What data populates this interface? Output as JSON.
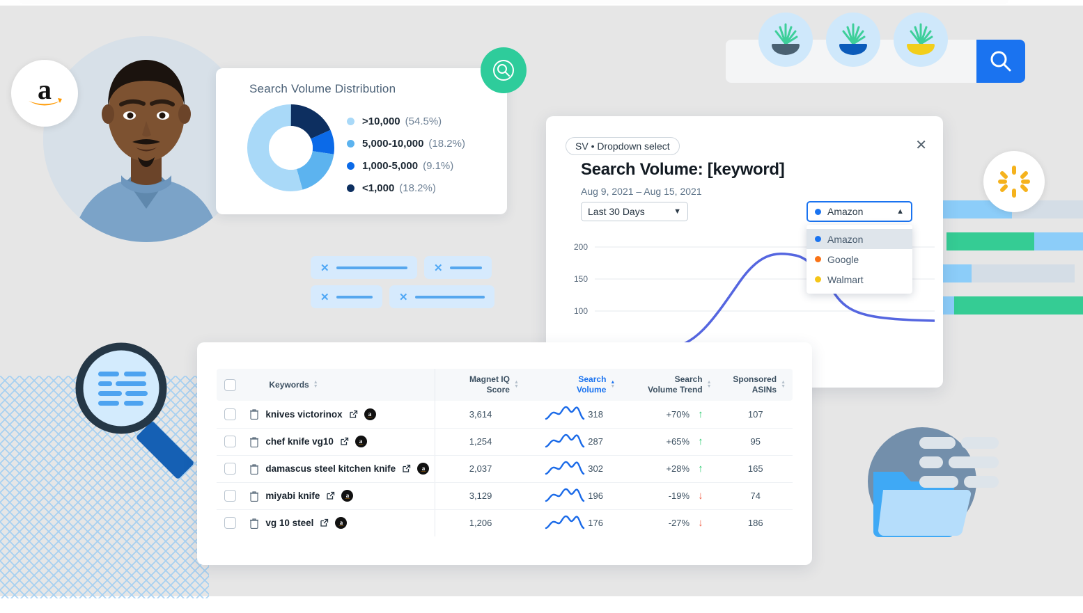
{
  "colors": {
    "accent_blue": "#1a73f0",
    "green": "#2ecc71",
    "red": "#f0634c",
    "amazon_orange": "#ff9900",
    "walmart_yellow": "#f5c518",
    "google_orange": "#f97316",
    "dot_amazon": "#1a73f0",
    "dot_google": "#f97316",
    "dot_walmart": "#f5c518"
  },
  "donut_card": {
    "title": "Search Volume Distribution",
    "legend": [
      {
        "label": ">10,000",
        "pct": "(54.5%)",
        "color": "#a9d9f8"
      },
      {
        "label": "5,000-10,000",
        "pct": "(18.2%)",
        "color": "#5cb3ef"
      },
      {
        "label": "1,000-5,000",
        "pct": "(9.1%)",
        "color": "#0b6ae8"
      },
      {
        "label": "<1,000",
        "pct": "(18.2%)",
        "color": "#0d2f60"
      }
    ]
  },
  "chart_data": [
    {
      "type": "pie",
      "title": "Search Volume Distribution",
      "categories": [
        ">10,000",
        "5,000-10,000",
        "1,000-5,000",
        "<1,000"
      ],
      "values": [
        54.5,
        18.2,
        9.1,
        18.2
      ],
      "colors": [
        "#a9d9f8",
        "#5cb3ef",
        "#0b6ae8",
        "#0d2f60"
      ],
      "legend_position": "right",
      "donut": true
    },
    {
      "type": "line",
      "title": "Search Volume: [keyword]",
      "subtitle": "Aug 9, 2021 – Aug 15, 2021",
      "series": [
        {
          "name": "Amazon",
          "color": "#5566e0",
          "values": [
            62,
            70,
            88,
            118,
            152,
            176,
            185,
            183,
            166,
            140,
            118,
            103,
            96,
            95
          ]
        }
      ],
      "x": [
        1,
        2,
        3,
        4,
        5,
        6,
        7,
        8,
        9,
        10,
        11,
        12,
        13,
        14
      ],
      "ytick_labels": [
        "200",
        "150",
        "100"
      ],
      "ylim": [
        50,
        215
      ],
      "grid": true,
      "xlabel": "",
      "ylabel": ""
    }
  ],
  "modal": {
    "tag": "SV • Dropdown select",
    "close_icon": "close-icon",
    "title": "Search Volume: [keyword]",
    "date_range": "Aug 9, 2021 – Aug 15, 2021",
    "range_select": {
      "value": "Last 30 Days"
    },
    "source_select": {
      "value": "Amazon",
      "options": [
        "Amazon",
        "Google",
        "Walmart"
      ],
      "option_colors": [
        "#1a73f0",
        "#f97316",
        "#f5c518"
      ],
      "selected_index": 0
    },
    "axis_ticks": [
      "200",
      "150",
      "100"
    ]
  },
  "table": {
    "columns": [
      {
        "label": "Keywords",
        "sorted": false
      },
      {
        "label_l1": "Magnet IQ",
        "label_l2": "Score",
        "sorted": false
      },
      {
        "label_l1": "Search",
        "label_l2": "Volume",
        "sorted": true
      },
      {
        "label_l1": "Search",
        "label_l2": "Volume Trend",
        "sorted": false
      },
      {
        "label_l1": "Sponsored",
        "label_l2": "ASINs",
        "sorted": false
      }
    ],
    "rows": [
      {
        "keyword": "knives victorinox",
        "iq": "3,614",
        "volume": "318",
        "trend": "+70%",
        "direction": "up",
        "asins": "107"
      },
      {
        "keyword": "chef knife vg10",
        "iq": "1,254",
        "volume": "287",
        "trend": "+65%",
        "direction": "up",
        "asins": "95"
      },
      {
        "keyword": "damascus steel kitchen knife",
        "iq": "2,037",
        "volume": "302",
        "trend": "+28%",
        "direction": "up",
        "asins": "165"
      },
      {
        "keyword": "miyabi knife",
        "iq": "3,129",
        "volume": "196",
        "trend": "-19%",
        "direction": "down",
        "asins": "74"
      },
      {
        "keyword": "vg 10 steel",
        "iq": "1,206",
        "volume": "176",
        "trend": "-27%",
        "direction": "down",
        "asins": "186"
      }
    ]
  },
  "decor": {
    "amazon_logo": "amazon-logo-icon",
    "walmart_logo": "walmart-logo-icon",
    "green_search": "search-icon",
    "magnifier": "magnifier-icon",
    "folder": "folder-icon",
    "plants": [
      "plant-dark-pot-icon",
      "plant-blue-pot-icon",
      "plant-yellow-pot-icon"
    ],
    "search_button": "search-icon"
  }
}
